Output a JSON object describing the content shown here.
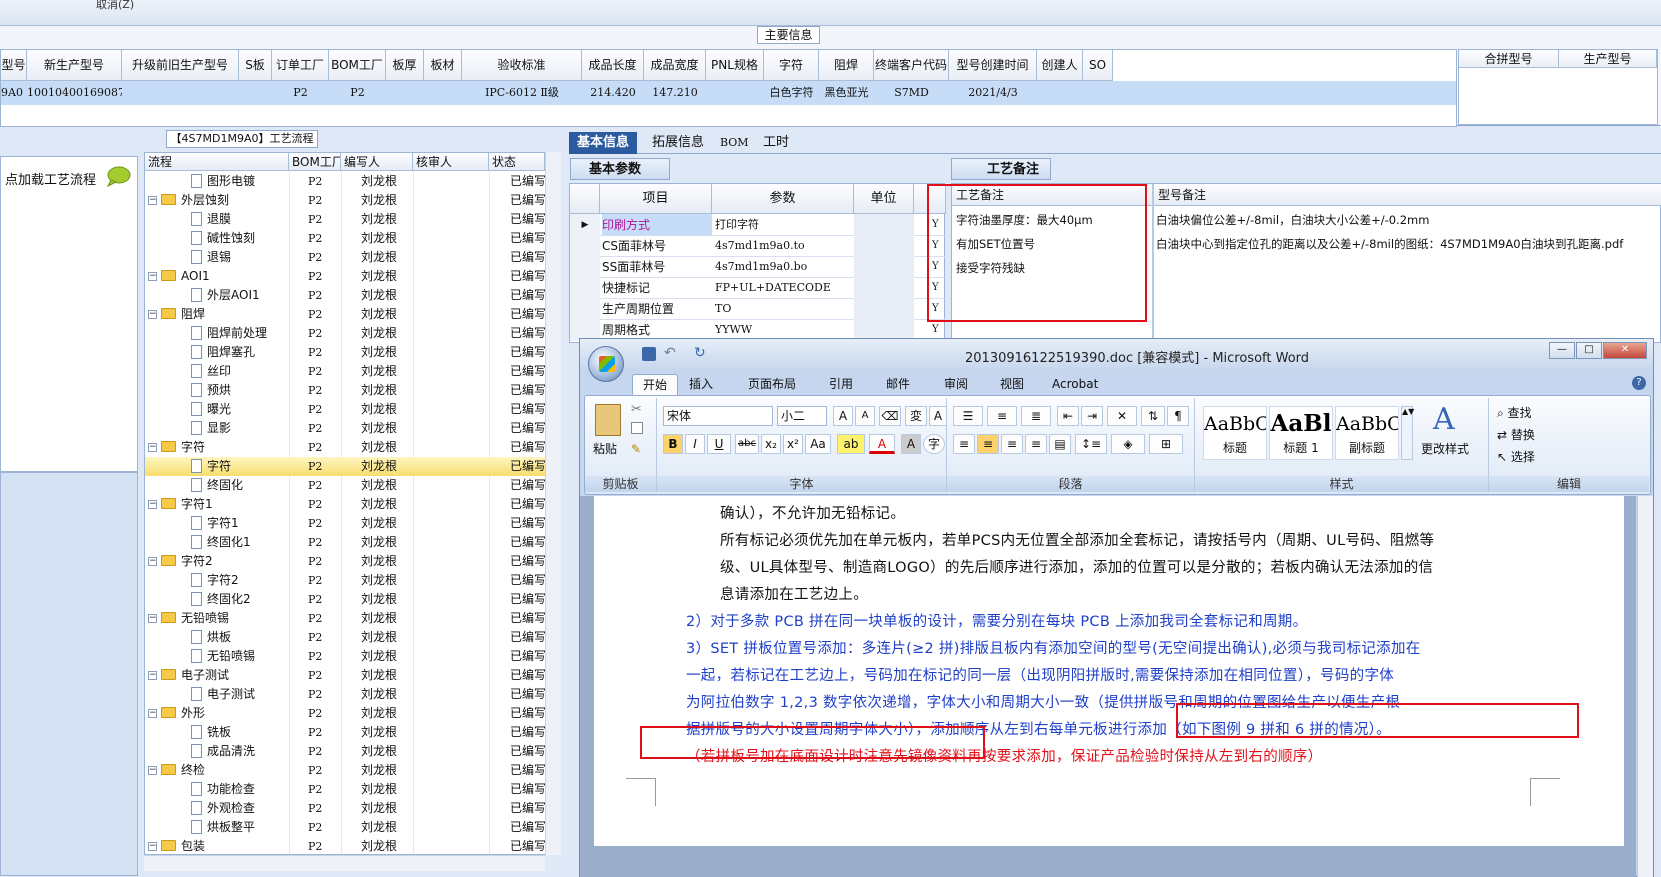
{
  "top": {
    "cancel_label": "取消(Z)"
  },
  "main_info": {
    "title": "主要信息",
    "columns": [
      "型号",
      "新生产型号",
      "升级前旧生产型号",
      "S板",
      "订单工厂",
      "BOM工厂",
      "板厚",
      "板材",
      "验收标准",
      "成品长度",
      "成品宽度",
      "PNL规格",
      "字符",
      "阻焊",
      "终端客户代码",
      "型号创建时间",
      "创建人",
      "SO"
    ],
    "row": [
      "9A0",
      "10010400169087",
      "",
      "",
      "P2",
      "P2",
      "",
      "",
      "IPC-6012 Ⅱ级",
      "214.420",
      "147.210",
      "",
      "白色字符",
      "黑色亚光",
      "S7MD",
      "2021/4/3",
      "",
      ""
    ],
    "side_columns": [
      "合拼型号",
      "生产型号"
    ]
  },
  "flow": {
    "title": "【4S7MD1M9A0】工艺流程",
    "load_label": "点加载工艺流程",
    "columns": [
      "流程",
      "BOM工厂",
      "编写人",
      "核审人",
      "状态"
    ],
    "rows": [
      {
        "name": "图形电镀",
        "bom": "P2",
        "writer": "刘龙根",
        "status": "已编写",
        "level": 2
      },
      {
        "name": "外层蚀刻",
        "bom": "P2",
        "writer": "刘龙根",
        "status": "已编写",
        "level": 1
      },
      {
        "name": "退膜",
        "bom": "P2",
        "writer": "刘龙根",
        "status": "已编写",
        "level": 2
      },
      {
        "name": "碱性蚀刻",
        "bom": "P2",
        "writer": "刘龙根",
        "status": "已编写",
        "level": 2
      },
      {
        "name": "退锡",
        "bom": "P2",
        "writer": "刘龙根",
        "status": "已编写",
        "level": 2
      },
      {
        "name": "AOI1",
        "bom": "P2",
        "writer": "刘龙根",
        "status": "已编写",
        "level": 1
      },
      {
        "name": "外层AOI1",
        "bom": "P2",
        "writer": "刘龙根",
        "status": "已编写",
        "level": 2
      },
      {
        "name": "阻焊",
        "bom": "P2",
        "writer": "刘龙根",
        "status": "已编写",
        "level": 1
      },
      {
        "name": "阻焊前处理",
        "bom": "P2",
        "writer": "刘龙根",
        "status": "已编写",
        "level": 2
      },
      {
        "name": "阻焊塞孔",
        "bom": "P2",
        "writer": "刘龙根",
        "status": "已编写",
        "level": 2
      },
      {
        "name": "丝印",
        "bom": "P2",
        "writer": "刘龙根",
        "status": "已编写",
        "level": 2
      },
      {
        "name": "预烘",
        "bom": "P2",
        "writer": "刘龙根",
        "status": "已编写",
        "level": 2
      },
      {
        "name": "曝光",
        "bom": "P2",
        "writer": "刘龙根",
        "status": "已编写",
        "level": 2
      },
      {
        "name": "显影",
        "bom": "P2",
        "writer": "刘龙根",
        "status": "已编写",
        "level": 2
      },
      {
        "name": "字符",
        "bom": "P2",
        "writer": "刘龙根",
        "status": "已编写",
        "level": 1
      },
      {
        "name": "字符",
        "bom": "P2",
        "writer": "刘龙根",
        "status": "已编写",
        "level": 2,
        "selected": true
      },
      {
        "name": "终固化",
        "bom": "P2",
        "writer": "刘龙根",
        "status": "已编写",
        "level": 2
      },
      {
        "name": "字符1",
        "bom": "P2",
        "writer": "刘龙根",
        "status": "已编写",
        "level": 1
      },
      {
        "name": "字符1",
        "bom": "P2",
        "writer": "刘龙根",
        "status": "已编写",
        "level": 2
      },
      {
        "name": "终固化1",
        "bom": "P2",
        "writer": "刘龙根",
        "status": "已编写",
        "level": 2
      },
      {
        "name": "字符2",
        "bom": "P2",
        "writer": "刘龙根",
        "status": "已编写",
        "level": 1
      },
      {
        "name": "字符2",
        "bom": "P2",
        "writer": "刘龙根",
        "status": "已编写",
        "level": 2
      },
      {
        "name": "终固化2",
        "bom": "P2",
        "writer": "刘龙根",
        "status": "已编写",
        "level": 2
      },
      {
        "name": "无铅喷锡",
        "bom": "P2",
        "writer": "刘龙根",
        "status": "已编写",
        "level": 1
      },
      {
        "name": "烘板",
        "bom": "P2",
        "writer": "刘龙根",
        "status": "已编写",
        "level": 2
      },
      {
        "name": "无铅喷锡",
        "bom": "P2",
        "writer": "刘龙根",
        "status": "已编写",
        "level": 2
      },
      {
        "name": "电子测试",
        "bom": "P2",
        "writer": "刘龙根",
        "status": "已编写",
        "level": 1
      },
      {
        "name": "电子测试",
        "bom": "P2",
        "writer": "刘龙根",
        "status": "已编写",
        "level": 2
      },
      {
        "name": "外形",
        "bom": "P2",
        "writer": "刘龙根",
        "status": "已编写",
        "level": 1
      },
      {
        "name": "铣板",
        "bom": "P2",
        "writer": "刘龙根",
        "status": "已编写",
        "level": 2
      },
      {
        "name": "成品清洗",
        "bom": "P2",
        "writer": "刘龙根",
        "status": "已编写",
        "level": 2
      },
      {
        "name": "终检",
        "bom": "P2",
        "writer": "刘龙根",
        "status": "已编写",
        "level": 1
      },
      {
        "name": "功能检查",
        "bom": "P2",
        "writer": "刘龙根",
        "status": "已编写",
        "level": 2
      },
      {
        "name": "外观检查",
        "bom": "P2",
        "writer": "刘龙根",
        "status": "已编写",
        "level": 2
      },
      {
        "name": "烘板整平",
        "bom": "P2",
        "writer": "刘龙根",
        "status": "已编写",
        "level": 2
      },
      {
        "name": "包装",
        "bom": "P2",
        "writer": "刘龙根",
        "status": "已编写",
        "level": 1
      }
    ]
  },
  "right_tabs": [
    "基本信息",
    "拓展信息",
    "BOM",
    "工时"
  ],
  "basic_params": {
    "tab": "基本参数",
    "columns": [
      "项目",
      "参数",
      "单位"
    ],
    "rows": [
      {
        "item": "印刷方式",
        "value": "打印字符",
        "flag": "Y"
      },
      {
        "item": "CS面菲林号",
        "value": "4s7md1m9a0.to",
        "flag": "Y"
      },
      {
        "item": "SS面菲林号",
        "value": "4s7md1m9a0.bo",
        "flag": "Y"
      },
      {
        "item": "快捷标记",
        "value": "FP+UL+DATECODE",
        "flag": "Y"
      },
      {
        "item": "生产周期位置",
        "value": "TO",
        "flag": "Y"
      },
      {
        "item": "周期格式",
        "value": "YYWW",
        "flag": "Y"
      }
    ]
  },
  "process_notes": {
    "tab": "工艺备注",
    "col_process": "工艺备注",
    "col_model": "型号备注",
    "process_lines": [
      "字符油墨厚度：最大40μm",
      "有加SET位置号",
      "接受字符残缺"
    ],
    "model_lines": [
      "白油块偏位公差+/-8mil，白油块大小公差+/-0.2mm",
      "白油块中心到指定位孔的距离以及公差+/-8mil的图纸：4S7MD1M9A0白油块到孔距离.pdf"
    ]
  },
  "word": {
    "title": "20130916122519390.doc [兼容模式] - Microsoft Word",
    "tabs": [
      "开始",
      "插入",
      "页面布局",
      "引用",
      "邮件",
      "审阅",
      "视图",
      "Acrobat"
    ],
    "font_name": "宋体",
    "font_size": "小二",
    "groups": [
      "剪贴板",
      "字体",
      "段落",
      "样式",
      "编辑"
    ],
    "paste_label": "粘贴",
    "styles": [
      {
        "sample": "AaBbC",
        "name": "标题"
      },
      {
        "sample": "AaBl",
        "name": "标题 1"
      },
      {
        "sample": "AaBbC",
        "name": "副标题"
      }
    ],
    "change_styles": "更改样式",
    "edit_items": [
      "查找",
      "替换",
      "选择"
    ],
    "doc_lines": [
      "确认），不允许加无铅标记。",
      "所有标记必须优先加在单元板内，若单PCS内无位置全部添加全套标记，请按括号内（周期、UL号码、阻燃等",
      "级、UL具体型号、制造商LOGO）的先后顺序进行添加，添加的位置可以是分散的；若板内确认无法添加的信",
      "息请添加在工艺边上。",
      "2）对于多款 PCB 拼在同一块单板的设计，需要分别在每块 PCB 上添加我司全套标记和周期。",
      "3）SET 拼板位置号添加：多连片(≥2 拼)排版且板内有添加空间的型号(无空间提出确认),必须与我司标记添加在",
      "一起，若标记在工艺边上，号码加在标记的同一层（出现阴阳拼版时,需要保持添加在相同位置），号码的字体",
      "为阿拉伯数字 1,2,3 数字依次递增，字体大小和周期大小一致（提供拼版号和周期的位置图给生产以便生产根",
      "据拼版号的大小设置周期字体大小），添加顺序从左到右每单元板进行添加（如下图例 9 拼和 6 拼的情况）。",
      "（若拼板号加在底面设计时注意先镜像资料再按要求添加，保证产品检验时保持从左到右的顺序）"
    ]
  }
}
